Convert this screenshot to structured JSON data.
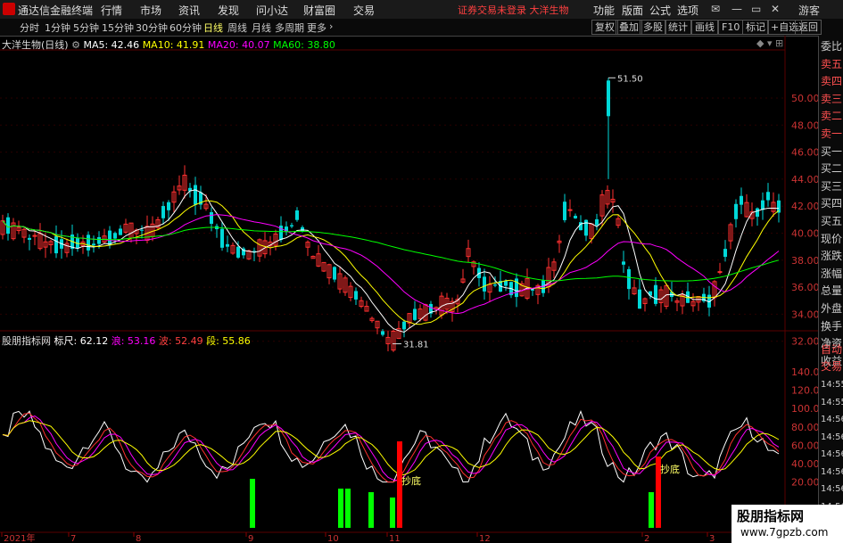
{
  "app": {
    "name": "通达信金融终端"
  },
  "menu": [
    "行情",
    "市场",
    "资讯",
    "发现",
    "问小达",
    "财富圈",
    "交易"
  ],
  "alert": "证券交易未登录 大洋生物",
  "top_right": [
    "功能",
    "版面",
    "公式",
    "选项"
  ],
  "guest": "游客",
  "periods": [
    "分时",
    "1分钟",
    "5分钟",
    "15分钟",
    "30分钟",
    "60分钟",
    "日线",
    "周线",
    "月线",
    "多周期",
    "更多"
  ],
  "active_period": "日线",
  "right_tools": [
    "复权",
    "叠加",
    "多股",
    "统计",
    "画线",
    "F10",
    "标记",
    "+自选",
    "返回"
  ],
  "main": {
    "title": "大洋生物(日线)",
    "ma": [
      {
        "label": "MA5: 42.46",
        "color": "#ffffff"
      },
      {
        "label": "MA10: 41.91",
        "color": "#ffff00"
      },
      {
        "label": "MA20: 40.07",
        "color": "#ff00ff"
      },
      {
        "label": "MA60: 38.80",
        "color": "#00ff00"
      }
    ],
    "max_label": "51.50",
    "min_label": "31.81",
    "yticks": [
      "50.00",
      "48.00",
      "46.00",
      "44.00",
      "42.00",
      "40.00",
      "38.00",
      "36.00",
      "34.00",
      "32.00"
    ]
  },
  "sub": {
    "title": "股朋指标网",
    "values": [
      {
        "label": "标尺: 62.12",
        "color": "#ffffff"
      },
      {
        "label": "浪: 53.16",
        "color": "#ff00ff"
      },
      {
        "label": "波: 52.49",
        "color": "#ff4040"
      },
      {
        "label": "段: 55.86",
        "color": "#ffff00"
      }
    ],
    "yticks": [
      "140.00",
      "120.00",
      "100.00",
      "80.00",
      "60.00",
      "40.00",
      "20.00"
    ],
    "signals": [
      "抄底",
      "抄底"
    ]
  },
  "xaxis": [
    "2021年",
    "7",
    "8",
    "9",
    "10",
    "11",
    "12",
    "2",
    "3"
  ],
  "right_panel": {
    "items": [
      "委比",
      "卖五",
      "卖四",
      "卖三",
      "卖二",
      "卖一",
      "买一",
      "买二",
      "买三",
      "买四",
      "买五",
      "现价",
      "涨跌",
      "涨幅",
      "总量",
      "外盘",
      "换手",
      "净资",
      "收益"
    ],
    "auto": [
      "自动",
      "交易"
    ],
    "times": [
      "14:55",
      "14:55",
      "14:56",
      "14:56",
      "14:56",
      "14:56",
      "14:56",
      "14:56"
    ]
  },
  "watermark": {
    "line1": "股朋指标网",
    "line2": "www.7gpzb.com"
  }
}
